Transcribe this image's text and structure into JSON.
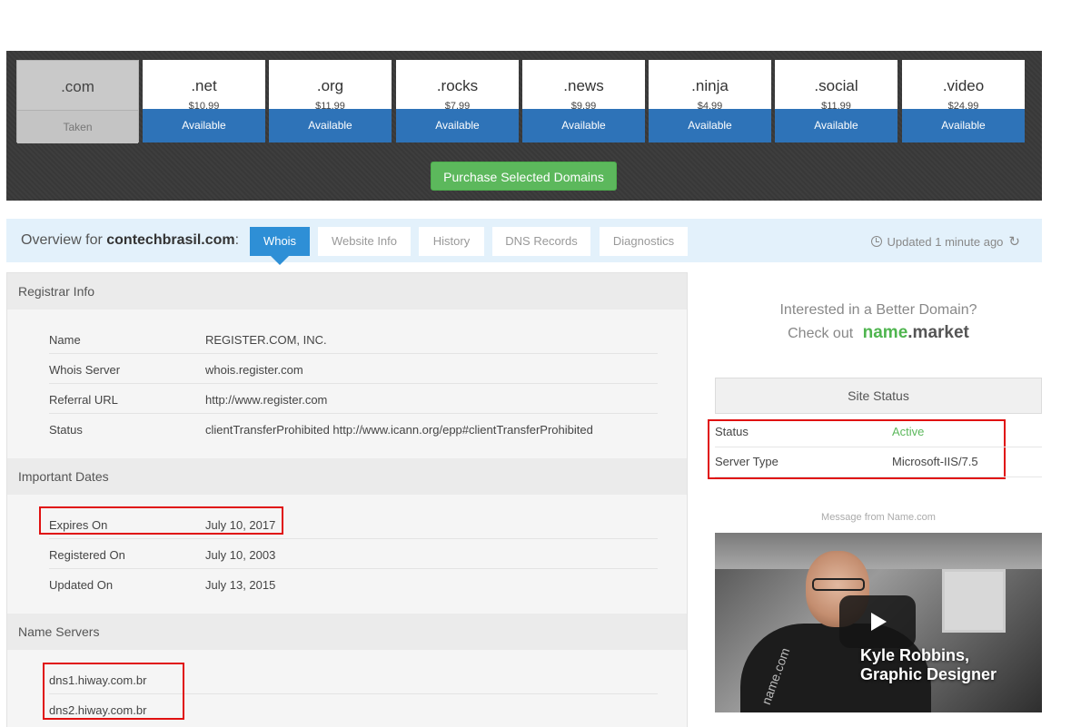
{
  "tlds": [
    {
      "ext": ".com",
      "price": "",
      "status": "Taken",
      "taken": true
    },
    {
      "ext": ".net",
      "price": "$10.99",
      "status": "Available",
      "taken": false
    },
    {
      "ext": ".org",
      "price": "$11.99",
      "status": "Available",
      "taken": false
    },
    {
      "ext": ".rocks",
      "price": "$7.99",
      "status": "Available",
      "taken": false
    },
    {
      "ext": ".news",
      "price": "$9.99",
      "status": "Available",
      "taken": false
    },
    {
      "ext": ".ninja",
      "price": "$4.99",
      "status": "Available",
      "taken": false
    },
    {
      "ext": ".social",
      "price": "$11.99",
      "status": "Available",
      "taken": false
    },
    {
      "ext": ".video",
      "price": "$24.99",
      "status": "Available",
      "taken": false
    }
  ],
  "purchase_button": "Purchase Selected Domains",
  "overview": {
    "prefix": "Overview for ",
    "domain": "contechbrasil.com",
    "suffix": ":",
    "tabs": [
      "Whois",
      "Website Info",
      "History",
      "DNS Records",
      "Diagnostics"
    ],
    "active_tab": "Whois",
    "updated": "Updated 1 minute ago"
  },
  "registrar": {
    "title": "Registrar Info",
    "rows": [
      {
        "label": "Name",
        "value": "REGISTER.COM, INC."
      },
      {
        "label": "Whois Server",
        "value": "whois.register.com"
      },
      {
        "label": "Referral URL",
        "value": "http://www.register.com"
      },
      {
        "label": "Status",
        "value": "clientTransferProhibited http://www.icann.org/epp#clientTransferProhibited"
      }
    ]
  },
  "dates": {
    "title": "Important Dates",
    "rows": [
      {
        "label": "Expires On",
        "value": "July 10, 2017"
      },
      {
        "label": "Registered On",
        "value": "July 10, 2003"
      },
      {
        "label": "Updated On",
        "value": "July 13, 2015"
      }
    ]
  },
  "nameservers": {
    "title": "Name Servers",
    "items": [
      "dns1.hiway.com.br",
      "dns2.hiway.com.br"
    ]
  },
  "promo": {
    "line1": "Interested in a Better Domain?",
    "line2": "Check out",
    "brand_a": "name",
    "brand_b": ".market"
  },
  "site_status": {
    "title": "Site Status",
    "rows": [
      {
        "label": "Status",
        "value": "Active"
      },
      {
        "label": "Server Type",
        "value": "Microsoft-IIS/7.5"
      }
    ]
  },
  "message_label": "Message from Name.com",
  "video": {
    "caption_line1": "Kyle Robbins,",
    "caption_line2": "Graphic Designer",
    "shirt_text": "name.com"
  },
  "colors": {
    "available": "#2e73b8",
    "active_tab": "#2e8fd6",
    "purchase": "#5cb85c",
    "highlight": "#e01010",
    "link": "#2a8bd6"
  }
}
